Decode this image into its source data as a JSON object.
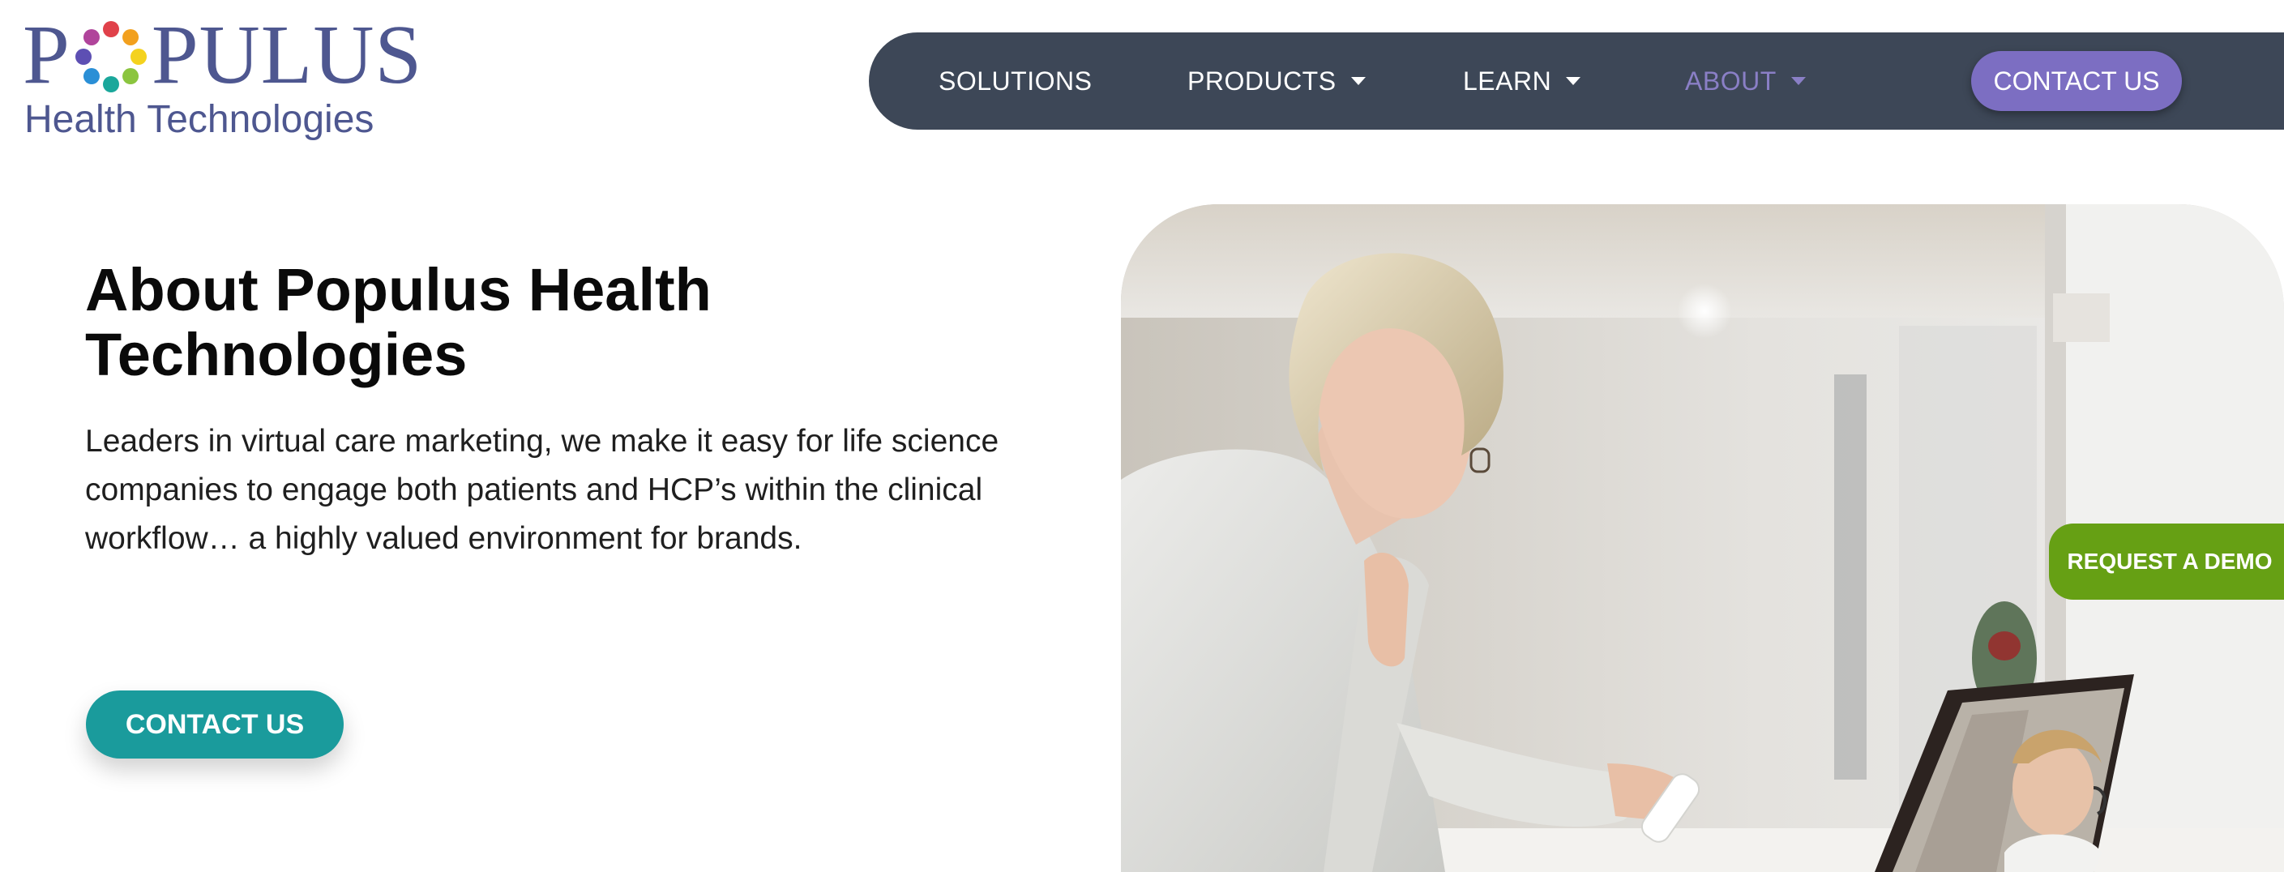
{
  "logo": {
    "wordmark_first": "P",
    "wordmark_rest": "PULUS",
    "subtitle": "Health Technologies",
    "brand_color": "#4e5790",
    "dot_colors": [
      "#e0414a",
      "#f2a01e",
      "#f4d21e",
      "#8bc53f",
      "#1aa79b",
      "#2a8fd6",
      "#5d4fb3",
      "#b0449b"
    ]
  },
  "nav": {
    "background": "#3d4757",
    "items": [
      {
        "label": "SOLUTIONS",
        "dropdown": false,
        "active": false
      },
      {
        "label": "PRODUCTS",
        "dropdown": true,
        "active": false
      },
      {
        "label": "LEARN",
        "dropdown": true,
        "active": false
      },
      {
        "label": "ABOUT",
        "dropdown": true,
        "active": true
      }
    ],
    "contact_label": "CONTACT US",
    "contact_color": "#7c6ec2"
  },
  "hero": {
    "title": "About Populus Health Technologies",
    "description": "Leaders in virtual care marketing, we make it easy for life science companies to engage both patients and HCP’s within the clinical workflow… a highly valued environment for brands.",
    "cta_label": "CONTACT US",
    "cta_color": "#1a9b9c"
  },
  "side_tab": {
    "label": "REQUEST A DEMO",
    "color": "#66a014"
  },
  "photo": {
    "subject": "woman-video-call-with-doctor-photo"
  }
}
